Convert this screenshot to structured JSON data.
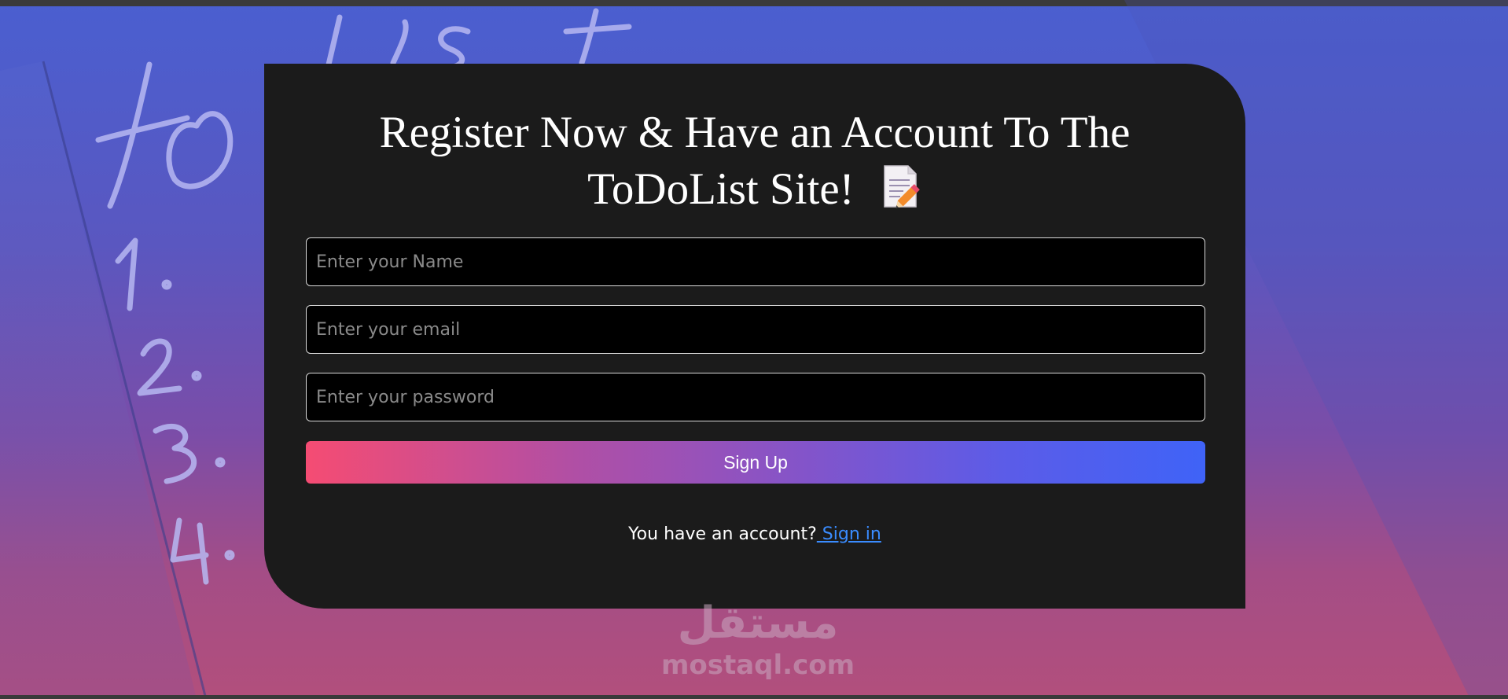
{
  "register_card": {
    "title_line1": "Register Now & Have an Account To The",
    "title_line2": "ToDoList Site!",
    "title_icon": "memo-icon",
    "name_placeholder": "Enter your Name",
    "email_placeholder": "Enter your email",
    "password_placeholder": "Enter your password",
    "signup_label": "Sign Up",
    "account_prompt": "You have an account?",
    "signin_label": " Sign in"
  },
  "background": {
    "chalk_heading": "to do list",
    "chalk_items": [
      "1.",
      "2.",
      "3.",
      "4."
    ]
  },
  "watermark": {
    "arabic": "مستقل",
    "domain": "mostaql.com"
  },
  "colors": {
    "card_bg": "#1b1b1b",
    "button_gradient_start": "#f54c73",
    "button_gradient_end": "#3f63f7",
    "link": "#3a8cff"
  }
}
